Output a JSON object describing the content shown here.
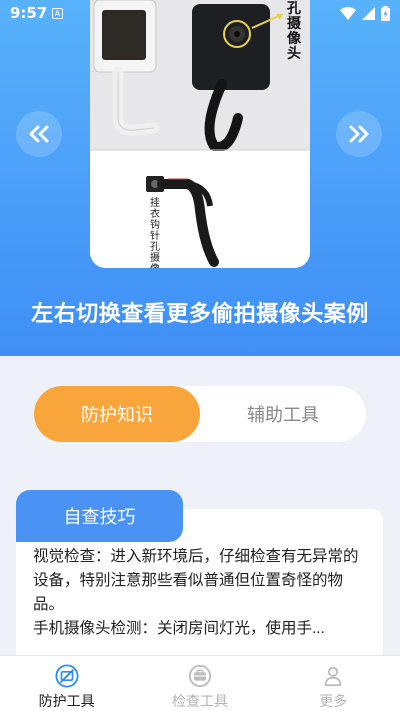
{
  "status_bar": {
    "time": "9:57",
    "notification_letter": "A"
  },
  "hero": {
    "image_text": {
      "side_label": "孔\n摄\n像\n头",
      "vertical_caption": "挂\n衣\n钩\n针\n孔\n摄\n像"
    },
    "caption": "左右切换查看更多偷拍摄像头案例",
    "prev_icon": "chevron-double-left",
    "next_icon": "chevron-double-right"
  },
  "tabs": [
    {
      "label": "防护知识",
      "active": true
    },
    {
      "label": "辅助工具",
      "active": false
    }
  ],
  "card": {
    "badge": "自查技巧",
    "paragraphs": [
      "视觉检查：进入新环境后，仔细检查有无异常的设备，特别注意那些看似普通但位置奇怪的物品。",
      "手机摄像头检测：关闭房间灯光，使用手..."
    ]
  },
  "bottom_nav": [
    {
      "label": "防护工具",
      "icon": "shield-camera-icon",
      "active": true
    },
    {
      "label": "检查工具",
      "icon": "toolbox-icon",
      "active": false
    },
    {
      "label": "更多",
      "icon": "person-icon",
      "active": false
    }
  ],
  "colors": {
    "accent_orange": "#f8a53c",
    "primary_blue": "#4a92f3",
    "hero_blue": "#4a9ef8"
  }
}
